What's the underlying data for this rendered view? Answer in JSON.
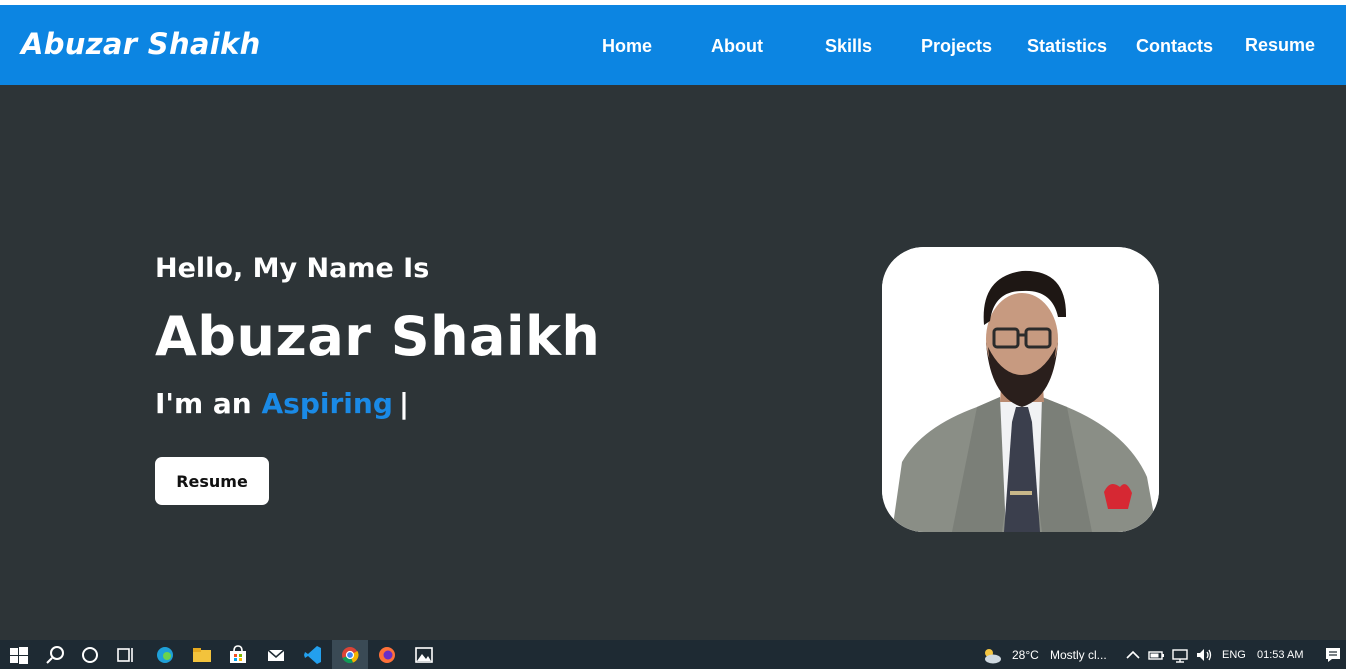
{
  "navbar": {
    "brand": "Abuzar Shaikh",
    "items": [
      {
        "label": "Home"
      },
      {
        "label": "About"
      },
      {
        "label": "Skills"
      },
      {
        "label": "Projects"
      },
      {
        "label": "Statistics"
      },
      {
        "label": "Contacts"
      },
      {
        "label": "Resume"
      }
    ],
    "color": "#0c85e2"
  },
  "hero": {
    "greeting": "Hello, My Name Is",
    "name": "Abuzar Shaikh",
    "role_prefix": "I'm an",
    "role_word": "Aspiring",
    "cursor": "|",
    "resume_button": "Resume",
    "background": "#2d3437",
    "accent": "#1a8ae6"
  },
  "taskbar": {
    "icons": [
      "windows-start-icon",
      "search-icon",
      "cortana-icon",
      "task-view-icon",
      "edge-icon",
      "file-explorer-icon",
      "store-icon",
      "mail-icon",
      "vscode-icon",
      "chrome-icon",
      "firefox-icon",
      "photos-icon"
    ],
    "weather": "28°C",
    "weather_desc": "Mostly cl...",
    "language": "ENG",
    "time": "01:53 AM"
  }
}
